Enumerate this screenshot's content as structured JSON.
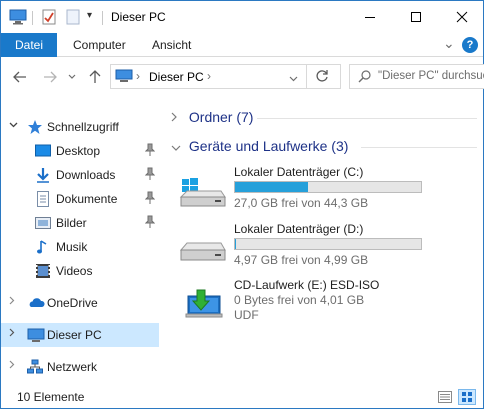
{
  "window": {
    "title": "Dieser PC",
    "quick_access_arrow": "▾"
  },
  "ribbon": {
    "tabs": [
      {
        "label": "Datei"
      },
      {
        "label": "Computer"
      },
      {
        "label": "Ansicht"
      }
    ],
    "collapse_chevron": "⌄",
    "help": "?"
  },
  "navigation": {
    "address_path": "Dieser PC",
    "address_separator": "›",
    "search_placeholder": "\"Dieser PC\" durchsuchen"
  },
  "sidebar": {
    "quick_access": "Schnellzugriff",
    "items": [
      {
        "label": "Desktop",
        "icon": "desktop-icon",
        "pinned": true
      },
      {
        "label": "Downloads",
        "icon": "downloads-icon",
        "pinned": true
      },
      {
        "label": "Dokumente",
        "icon": "documents-icon",
        "pinned": true
      },
      {
        "label": "Bilder",
        "icon": "pictures-icon",
        "pinned": true
      },
      {
        "label": "Musik",
        "icon": "music-icon",
        "pinned": false
      },
      {
        "label": "Videos",
        "icon": "videos-icon",
        "pinned": false
      }
    ],
    "onedrive": "OneDrive",
    "this_pc": "Dieser PC",
    "network": "Netzwerk"
  },
  "content": {
    "folders_group": "Ordner (7)",
    "devices_group": "Geräte und Laufwerke (3)",
    "drives": [
      {
        "name": "Lokaler Datenträger (C:)",
        "free_text": "27,0 GB frei von 44,3 GB",
        "used_fraction": 0.39,
        "icon": "windows-drive-icon"
      },
      {
        "name": "Lokaler Datenträger (D:)",
        "free_text": "4,97 GB frei von 4,99 GB",
        "used_fraction": 0.004,
        "icon": "hard-drive-icon"
      },
      {
        "name": "CD-Laufwerk (E:) ESD-ISO",
        "free_text": "0 Bytes frei von 4,01 GB",
        "filesystem": "UDF",
        "icon": "cd-drive-icon"
      }
    ]
  },
  "status_bar": {
    "item_count": "10 Elemente"
  },
  "colors": {
    "accent": "#1979ca",
    "selection": "#cce8ff",
    "bar_fill": "#26a0da",
    "group_header": "#1e3287"
  }
}
